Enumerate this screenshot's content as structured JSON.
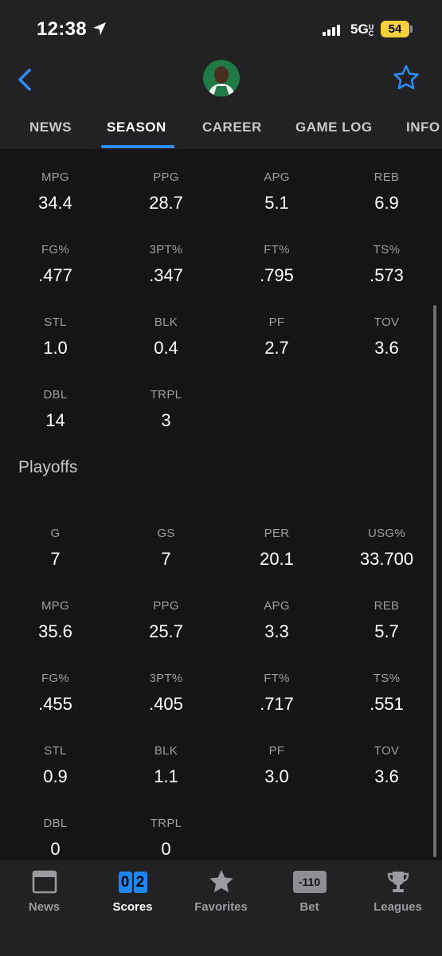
{
  "status": {
    "time": "12:38",
    "network": "5G",
    "network_suffix": "UC",
    "battery": "54"
  },
  "tabs": [
    "NEWS",
    "SEASON",
    "CAREER",
    "GAME LOG",
    "INFO"
  ],
  "season": [
    [
      {
        "label": "MPG",
        "value": "34.4"
      },
      {
        "label": "PPG",
        "value": "28.7"
      },
      {
        "label": "APG",
        "value": "5.1"
      },
      {
        "label": "REB",
        "value": "6.9"
      }
    ],
    [
      {
        "label": "FG%",
        "value": ".477"
      },
      {
        "label": "3PT%",
        "value": ".347"
      },
      {
        "label": "FT%",
        "value": ".795"
      },
      {
        "label": "TS%",
        "value": ".573"
      }
    ],
    [
      {
        "label": "STL",
        "value": "1.0"
      },
      {
        "label": "BLK",
        "value": "0.4"
      },
      {
        "label": "PF",
        "value": "2.7"
      },
      {
        "label": "TOV",
        "value": "3.6"
      }
    ],
    [
      {
        "label": "DBL",
        "value": "14"
      },
      {
        "label": "TRPL",
        "value": "3"
      }
    ]
  ],
  "playoffs_title": "Playoffs",
  "playoffs": [
    [
      {
        "label": "G",
        "value": "7"
      },
      {
        "label": "GS",
        "value": "7"
      },
      {
        "label": "PER",
        "value": "20.1"
      },
      {
        "label": "USG%",
        "value": "33.700"
      }
    ],
    [
      {
        "label": "MPG",
        "value": "35.6"
      },
      {
        "label": "PPG",
        "value": "25.7"
      },
      {
        "label": "APG",
        "value": "3.3"
      },
      {
        "label": "REB",
        "value": "5.7"
      }
    ],
    [
      {
        "label": "FG%",
        "value": ".455"
      },
      {
        "label": "3PT%",
        "value": ".405"
      },
      {
        "label": "FT%",
        "value": ".717"
      },
      {
        "label": "TS%",
        "value": ".551"
      }
    ],
    [
      {
        "label": "STL",
        "value": "0.9"
      },
      {
        "label": "BLK",
        "value": "1.1"
      },
      {
        "label": "PF",
        "value": "3.0"
      },
      {
        "label": "TOV",
        "value": "3.6"
      }
    ],
    [
      {
        "label": "DBL",
        "value": "0"
      },
      {
        "label": "TRPL",
        "value": "0"
      }
    ]
  ],
  "bottom_nav": [
    {
      "label": "News",
      "icon": "news-icon"
    },
    {
      "label": "Scores",
      "icon": "scores-icon",
      "digits": [
        "0",
        "2"
      ]
    },
    {
      "label": "Favorites",
      "icon": "star-icon"
    },
    {
      "label": "Bet",
      "icon": "bet-icon",
      "badge": "-110"
    },
    {
      "label": "Leagues",
      "icon": "trophy-icon"
    }
  ],
  "colors": {
    "accent": "#2f8cf5",
    "background": "#151517",
    "bar": "#222224",
    "battery": "#f7cf3d",
    "team_green": "#1f7a45"
  }
}
